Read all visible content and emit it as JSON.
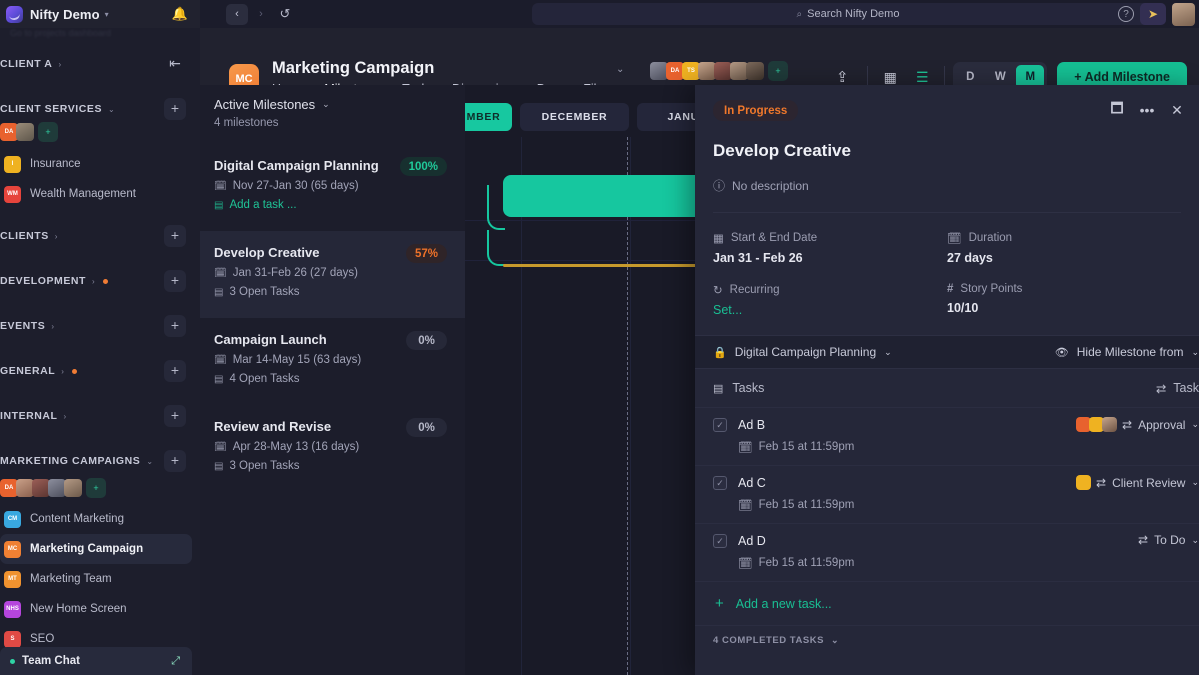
{
  "chrome": {
    "brand": "Nifty Demo",
    "brand_chevron": "▾",
    "bell_icon": "🔔",
    "back_icon": "‹",
    "forward_icon": "›",
    "history_icon": "↺",
    "search_icon": "⌕",
    "search_placeholder": "Search Nifty Demo",
    "help_icon": "?",
    "extension_icon": "➤"
  },
  "sidebar": {
    "ghost_row": "Go to projects dashboard",
    "sections": [
      {
        "label": "CLIENT A",
        "arrow": "›",
        "dot": false,
        "plus": "⇤",
        "plus_plain": true
      },
      {
        "label": "CLIENT SERVICES",
        "arrow": "⌄",
        "dot": false,
        "plus": "+",
        "plus_plain": false
      },
      {
        "label": "CLIENTS",
        "arrow": "›",
        "dot": false,
        "plus": "+",
        "plus_plain": false
      },
      {
        "label": "DEVELOPMENT",
        "arrow": "›",
        "dot": true,
        "plus": "+",
        "plus_plain": false
      },
      {
        "label": "EVENTS",
        "arrow": "›",
        "dot": false,
        "plus": "+",
        "plus_plain": false
      },
      {
        "label": "GENERAL",
        "arrow": "›",
        "dot": true,
        "plus": "+",
        "plus_plain": false
      },
      {
        "label": "INTERNAL",
        "arrow": "›",
        "dot": false,
        "plus": "+",
        "plus_plain": false
      },
      {
        "label": "MARKETING CAMPAIGNS",
        "arrow": "⌄",
        "dot": false,
        "plus": "+",
        "plus_plain": false
      }
    ],
    "client_services_projects": [
      {
        "initials": "I",
        "label": "Insurance",
        "color": "#efb221"
      },
      {
        "initials": "WM",
        "label": "Wealth Management",
        "color": "#e6443c"
      }
    ],
    "marketing_projects": [
      {
        "initials": "CM",
        "label": "Content Marketing",
        "color": "#39a8e0",
        "active": false
      },
      {
        "initials": "MC",
        "label": "Marketing Campaign",
        "color": "#f08033",
        "active": true
      },
      {
        "initials": "MT",
        "label": "Marketing Team",
        "color": "#f0922f",
        "active": false
      },
      {
        "initials": "NHS",
        "label": "New Home Screen",
        "color": "#b545dd",
        "active": false
      },
      {
        "initials": "S",
        "label": "SEO",
        "color": "#e04a45",
        "active": false
      }
    ],
    "add_member_icon": "+",
    "team_chat": {
      "label": "Team Chat",
      "expand_icon": "⤢"
    }
  },
  "project_header": {
    "avatar_initials": "MC",
    "title": "Marketing Campaign",
    "title_chevron": "⌄",
    "breadcrumb": "Home",
    "breadcrumb_sep": "›",
    "tabs": [
      {
        "label": "Milestones",
        "active": true
      },
      {
        "label": "Tasks",
        "active": false
      },
      {
        "label": "Discussions",
        "active": false
      },
      {
        "label": "Docs",
        "active": false
      },
      {
        "label": "Files",
        "active": false
      }
    ],
    "share_icon": "⇪",
    "grid_view_icon": "▦",
    "list_view_icon": "☰",
    "zoom_levels": [
      {
        "label": "D",
        "on": false
      },
      {
        "label": "W",
        "on": false
      },
      {
        "label": "M",
        "on": true
      }
    ],
    "add_milestone_label": "+ Add Milestone"
  },
  "milestones_panel": {
    "filter_label": "Active Milestones",
    "filter_chevron": "⌄",
    "count_label": "4 milestones",
    "calendar_icon": "🗓",
    "task_icon": "▤",
    "items": [
      {
        "name": "Digital Campaign Planning",
        "dates": "Nov 27-Jan 30 (65 days)",
        "tasks": "Add a task ...",
        "tasks_is_link": true,
        "percent": "100%",
        "pct_class": "p100",
        "highlight": false
      },
      {
        "name": "Develop Creative",
        "dates": "Jan 31-Feb 26 (27 days)",
        "tasks": "3 Open Tasks",
        "tasks_is_link": false,
        "percent": "57%",
        "pct_class": "p57",
        "highlight": true
      },
      {
        "name": "Campaign Launch",
        "dates": "Mar 14-May 15 (63 days)",
        "tasks": "4 Open Tasks",
        "tasks_is_link": false,
        "percent": "0%",
        "pct_class": "p0",
        "highlight": false
      },
      {
        "name": "Review and Revise",
        "dates": "Apr 28-May 13 (16 days)",
        "tasks": "3 Open Tasks",
        "tasks_is_link": false,
        "percent": "0%",
        "pct_class": "p0",
        "highlight": false
      }
    ]
  },
  "gantt": {
    "months": [
      {
        "label": "MBER",
        "current": true
      },
      {
        "label": "DECEMBER",
        "current": false
      },
      {
        "label": "JANUAR",
        "current": false
      }
    ]
  },
  "detail": {
    "status_badge": "In Progress",
    "minimize_icon": "🗖",
    "more_icon": "•••",
    "close_icon": "✕",
    "title": "Develop Creative",
    "description_icon": "ⓘ",
    "description": "No description",
    "fields": [
      {
        "icon": "▦",
        "label": "Start & End Date",
        "value": "Jan 31 - Feb 26",
        "link": false
      },
      {
        "icon": "🗓",
        "label": "Duration",
        "value": "27 days",
        "link": false
      },
      {
        "icon": "↻",
        "label": "Recurring",
        "value": "Set...",
        "link": true
      },
      {
        "icon": "#",
        "label": "Story Points",
        "value": "10/10",
        "link": false
      }
    ],
    "subbar": {
      "lock_icon": "🔒",
      "milestone_name": "Digital Campaign Planning",
      "milestone_chevron": "⌄",
      "eye_icon": "👁",
      "hide_label": "Hide Milestone from",
      "hide_chevron": "⌄"
    },
    "tasks_header": {
      "icon": "▤",
      "label": "Tasks",
      "swap_icon": "⇄",
      "right_label": "Task"
    },
    "tasks": [
      {
        "name": "Ad B",
        "date_icon": "🗓",
        "date": "Feb 15 at 11:59pm",
        "status": "Approval",
        "status_icon": "⇄",
        "chevron": "⌄",
        "avatars": [
          "#e8622e",
          "#efb221",
          "#8b6f59"
        ]
      },
      {
        "name": "Ad C",
        "date_icon": "🗓",
        "date": "Feb 15 at 11:59pm",
        "status": "Client Review",
        "status_icon": "⇄",
        "chevron": "⌄",
        "avatars": [
          "#efb221"
        ]
      },
      {
        "name": "Ad D",
        "date_icon": "🗓",
        "date": "Feb 15 at 11:59pm",
        "status": "To Do",
        "status_icon": "⇄",
        "chevron": "⌄",
        "avatars": []
      }
    ],
    "add_task_label": "Add a new task...",
    "add_task_plus": "+",
    "completed_label": "4 COMPLETED TASKS",
    "completed_chevron": "⌄",
    "check_icon": "✓"
  }
}
